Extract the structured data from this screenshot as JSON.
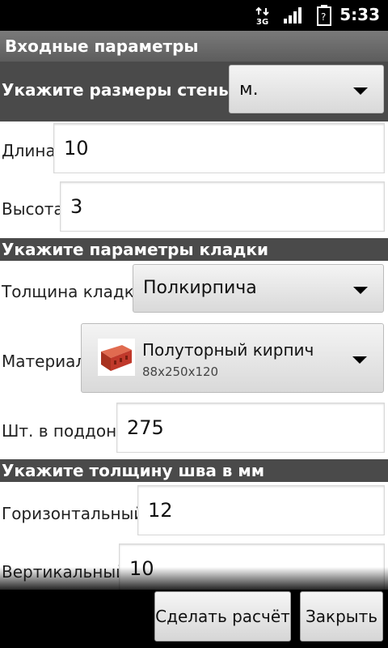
{
  "status_bar": {
    "network": "3G",
    "time": "5:33",
    "icons": [
      "data-arrows-icon",
      "signal-bars-icon",
      "battery-unknown-icon"
    ]
  },
  "title": "Входные параметры",
  "wall": {
    "header": "Укажите размеры стены в",
    "unit_selected": "м.",
    "length_label": "Длина",
    "length_value": "10",
    "height_label": "Высота",
    "height_value": "3"
  },
  "masonry": {
    "header": "Укажите параметры кладки",
    "thickness_label": "Толщина кладки",
    "thickness_selected": "Полкирпича",
    "material_label": "Материал",
    "material_name": "Полуторный кирпич",
    "material_size": "88x250x120",
    "pallet_label": "Шт. в поддоне",
    "pallet_value": "275"
  },
  "joint": {
    "header": "Укажите толщину шва в мм",
    "horizontal_label": "Горизонтальный",
    "horizontal_value": "12",
    "vertical_label": "Вертикальный",
    "vertical_value": "10"
  },
  "buttons": {
    "calculate": "Сделать расчёт",
    "close": "Закрыть"
  },
  "colors": {
    "section_bg": "#4a4a4a",
    "titlebar_bg": "#6b6b6b",
    "brick": "#c0392b"
  }
}
